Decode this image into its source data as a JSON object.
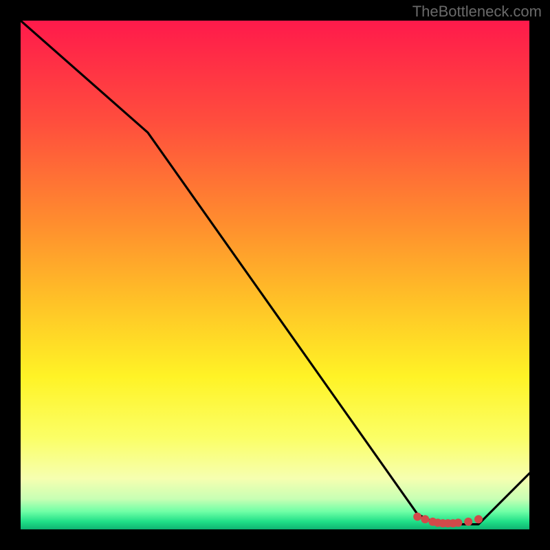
{
  "watermark": "TheBottleneck.com",
  "chart_data": {
    "type": "line",
    "title": "",
    "xlabel": "",
    "ylabel": "",
    "xlim": [
      0,
      100
    ],
    "ylim": [
      0,
      100
    ],
    "series": [
      {
        "name": "curve",
        "x": [
          0,
          25,
          78,
          82,
          90,
          100
        ],
        "values": [
          100,
          78,
          3,
          1,
          1,
          11
        ]
      }
    ],
    "markers": {
      "x": [
        78,
        79.5,
        81,
        82,
        83,
        84,
        85,
        86,
        88,
        90
      ],
      "y": [
        2.5,
        2,
        1.5,
        1.3,
        1.2,
        1.2,
        1.2,
        1.3,
        1.5,
        2
      ],
      "color": "#d24a4a",
      "size": 6
    },
    "gradient_stops": [
      {
        "offset": 0.0,
        "color": "#ff1a4b"
      },
      {
        "offset": 0.2,
        "color": "#ff4e3d"
      },
      {
        "offset": 0.4,
        "color": "#ff8e2e"
      },
      {
        "offset": 0.55,
        "color": "#ffc127"
      },
      {
        "offset": 0.7,
        "color": "#fff326"
      },
      {
        "offset": 0.82,
        "color": "#fbff66"
      },
      {
        "offset": 0.9,
        "color": "#f6ffb0"
      },
      {
        "offset": 0.94,
        "color": "#c8ffb4"
      },
      {
        "offset": 0.965,
        "color": "#6fffa6"
      },
      {
        "offset": 0.985,
        "color": "#1fdf87"
      },
      {
        "offset": 1.0,
        "color": "#0fb372"
      }
    ]
  }
}
